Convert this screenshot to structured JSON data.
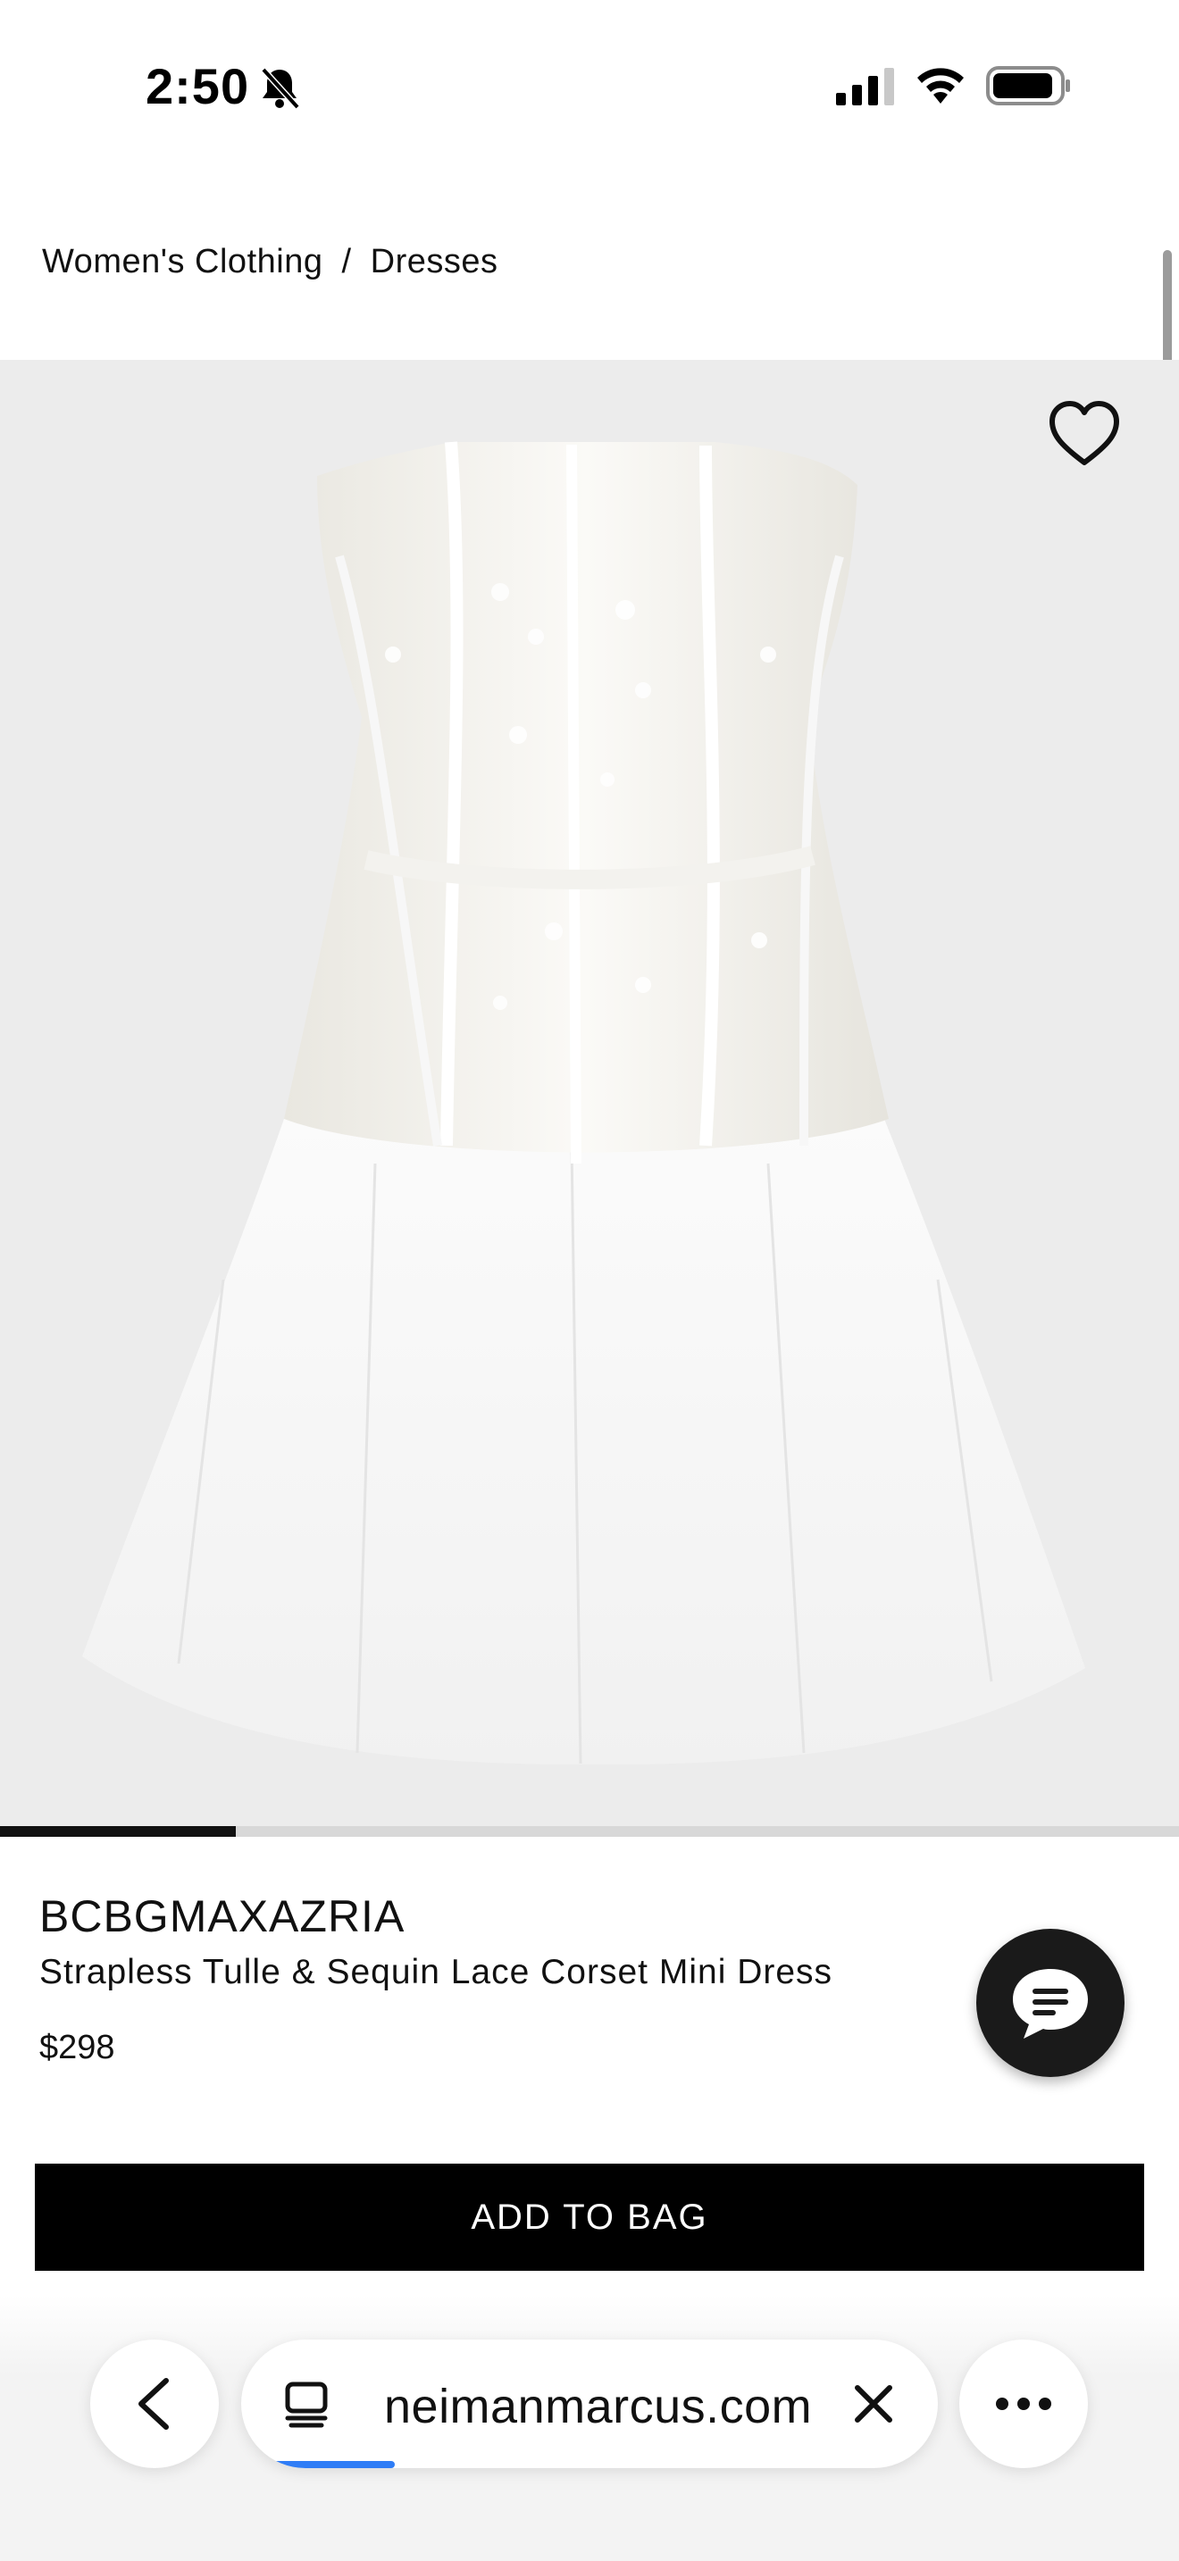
{
  "status_bar": {
    "time": "2:50",
    "icons": [
      "bell-slash-icon",
      "cellular-signal-icon",
      "wifi-icon",
      "battery-icon"
    ]
  },
  "breadcrumb": {
    "items": [
      "Women's Clothing",
      "Dresses"
    ],
    "separator": "/"
  },
  "hero": {
    "image": "white-strapless-corset-mini-dress",
    "favorite_icon": "heart-outline-icon",
    "carousel_progress": 0.2
  },
  "product": {
    "brand": "BCBGMAXAZRIA",
    "name": "Strapless Tulle & Sequin Lace Corset Mini Dress",
    "price": "$298"
  },
  "chat": {
    "icon": "chat-bubble-icon"
  },
  "cta": {
    "add_to_bag": "ADD TO BAG"
  },
  "browser": {
    "url": "neimanmarcus.com",
    "back_icon": "chevron-left-icon",
    "tabs_icon": "tabs-icon",
    "close_icon": "close-icon",
    "more_icon": "more-horizontal-icon",
    "load_progress": 0.18,
    "accent": "#2f7df6"
  },
  "colors": {
    "cta_background": "#000000",
    "hero_background": "#ececec"
  }
}
